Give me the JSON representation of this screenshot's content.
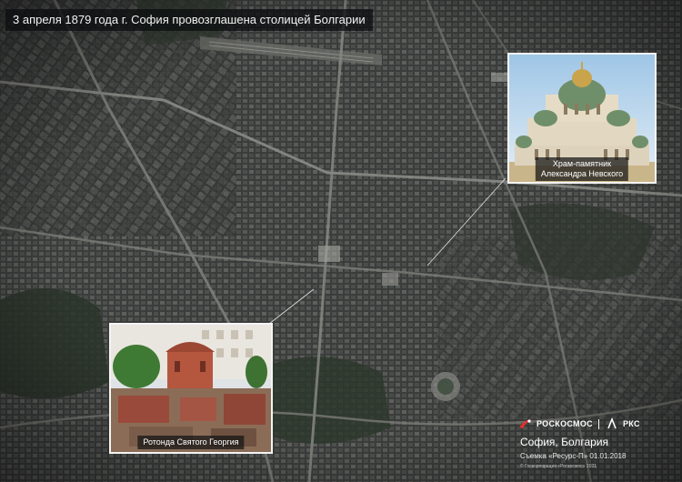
{
  "title": "3 апреля 1879 года г. София провозглашена столицей Болгарии",
  "insets": {
    "cathedral": {
      "caption_line1": "Храм-памятник",
      "caption_line2": "Александра Невского"
    },
    "rotunda": {
      "caption": "Ротонда Святого Георгия"
    }
  },
  "branding": {
    "roscosmos": "РОСКОСМОС",
    "rks": "РКС",
    "location": "София, Болгария",
    "survey": "Съемка «Ресурс-П» 01.01.2018",
    "copyright": "© Госкорпорация «Роскосмос» 2021"
  },
  "colors": {
    "banner_bg": "#0a0c0e",
    "inset_border": "#f4f4f4",
    "leader_line": "#e0e0e0"
  }
}
